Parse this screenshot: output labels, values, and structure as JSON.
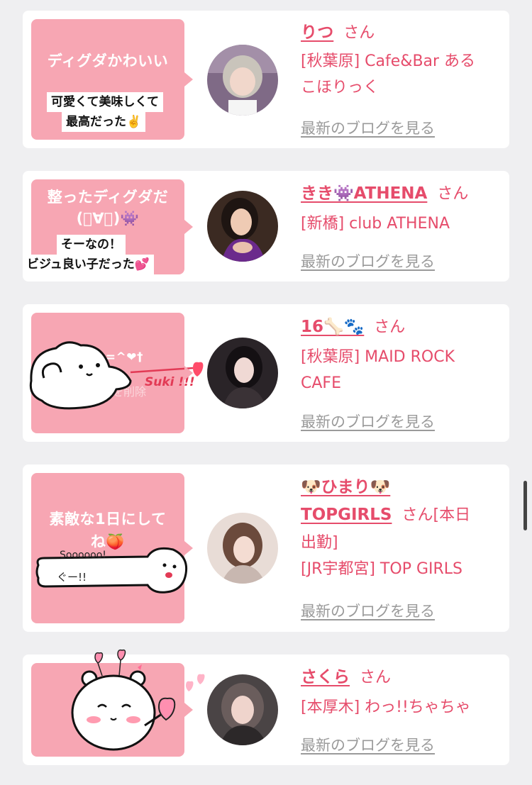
{
  "cards": [
    {
      "bubble_text": "ディグダかわいい",
      "caption": [
        "可愛くて美味しくて",
        "最高だった✌️"
      ],
      "name": "りつ",
      "honorific": "さん",
      "lines": [
        "[秋葉原] Cafe&Bar ある",
        "こほりっく"
      ],
      "blog_link": "最新のブログを見る"
    },
    {
      "bubble_text": [
        "整ったディグダだ",
        "(ﾟ∀ﾟ)👾"
      ],
      "caption": [
        "そーなの！",
        "ビジュ良い子だった💕"
      ],
      "name": "きき👾ATHENA",
      "honorific": "さん",
      "lines": [
        "[新橋] club ATHENA"
      ],
      "blog_link": "最新のブログを見る"
    },
    {
      "bubble_text": "~=^❤†",
      "faint": "ジを削除",
      "sticker_text": "Suki !!!",
      "name": "16🦴🐾",
      "honorific": "さん",
      "lines": [
        "[秋葉原] MAID ROCK",
        "CAFE"
      ],
      "blog_link": "最新のブログを見る"
    },
    {
      "bubble_text": [
        "素敵な1日にして",
        "ね🍑"
      ],
      "sticker_text": [
        "Soooooo!",
        "ぐー!!"
      ],
      "name": "🐶ひまり🐶",
      "name2": "TOPGIRLS",
      "honorific": "さん",
      "extra": "[本日",
      "lines": [
        "出勤]",
        "[JR宇都宮] TOP GIRLS"
      ],
      "blog_link": "最新のブログを見る"
    },
    {
      "name": "さくら",
      "honorific": "さん",
      "lines": [
        "[本厚木] わっ!!ちゃちゃ"
      ],
      "blog_link": "最新のブログを見る"
    }
  ]
}
